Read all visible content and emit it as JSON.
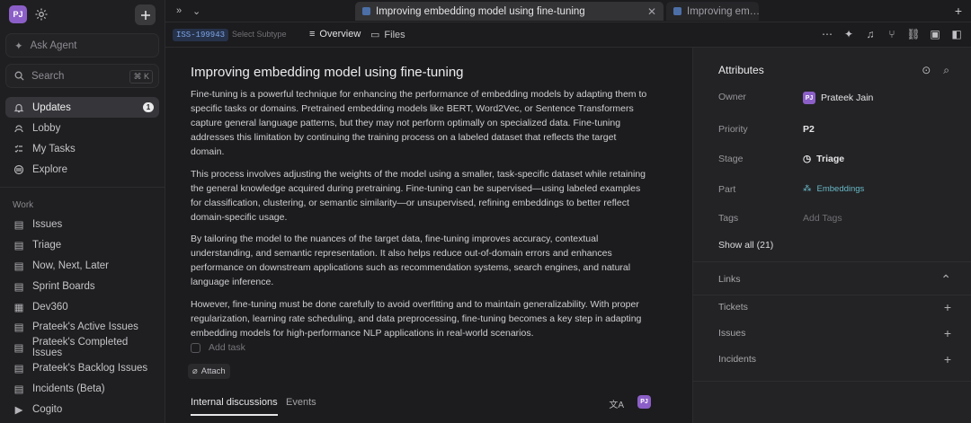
{
  "user": {
    "initials": "PJ"
  },
  "sidebar": {
    "ask_agent": "Ask Agent",
    "search_placeholder": "Search",
    "search_shortcut": "⌘ K",
    "nav": [
      {
        "label": "Updates",
        "badge": "1",
        "icon": "bell-icon"
      },
      {
        "label": "Lobby",
        "icon": "lobby-icon"
      },
      {
        "label": "My Tasks",
        "icon": "tasks-icon"
      },
      {
        "label": "Explore",
        "icon": "explore-icon"
      }
    ],
    "work_label": "Work",
    "work": [
      "Issues",
      "Triage",
      "Now, Next, Later",
      "Sprint Boards",
      "Dev360",
      "Prateek's Active Issues",
      "Prateek's Completed Issues",
      "Prateek's Backlog Issues",
      "Incidents (Beta)",
      "Cogito"
    ]
  },
  "tabs": {
    "active": "Improving embedding model using fine-tuning",
    "inactive": "Improving em…"
  },
  "toolbar": {
    "issue_id": "ISS-199943",
    "subtype": "Select Subtype",
    "overview": "Overview",
    "files": "Files"
  },
  "issue": {
    "title": "Improving embedding model using fine-tuning",
    "paragraphs": [
      "Fine-tuning is a powerful technique for enhancing the performance of embedding models by adapting them to specific tasks or domains. Pretrained embedding models like BERT, Word2Vec, or Sentence Transformers capture general language patterns, but they may not perform optimally on specialized data. Fine-tuning addresses this limitation by continuing the training process on a labeled dataset that reflects the target domain.",
      "This process involves adjusting the weights of the model using a smaller, task-specific dataset while retaining the general knowledge acquired during pretraining. Fine-tuning can be supervised—using labeled examples for classification, clustering, or semantic similarity—or unsupervised, refining embeddings to better reflect domain-specific usage.",
      "By tailoring the model to the nuances of the target data, fine-tuning improves accuracy, contextual understanding, and semantic representation. It also helps reduce out-of-domain errors and enhances performance on downstream applications such as recommendation systems, search engines, and natural language inference.",
      "However, fine-tuning must be done carefully to avoid overfitting and to maintain generalizability. With proper regularization, learning rate scheduling, and data preprocessing, fine-tuning becomes a key step in adapting embedding models for high-performance NLP applications in real-world scenarios."
    ],
    "add_task": "Add task",
    "attach": "Attach",
    "tabs": [
      "Internal discussions",
      "Events"
    ]
  },
  "attributes": {
    "title": "Attributes",
    "owner_label": "Owner",
    "owner_value": "Prateek Jain",
    "priority_label": "Priority",
    "priority_value": "P2",
    "stage_label": "Stage",
    "stage_value": "Triage",
    "part_label": "Part",
    "part_value": "Embeddings",
    "tags_label": "Tags",
    "tags_placeholder": "Add Tags",
    "show_all": "Show all (21)",
    "links": "Links",
    "tickets": "Tickets",
    "issues": "Issues",
    "incidents": "Incidents"
  },
  "colors": {
    "accent": "#8b5fc7",
    "part_link": "#68b8c7",
    "issue_id": "#7da6e8"
  }
}
